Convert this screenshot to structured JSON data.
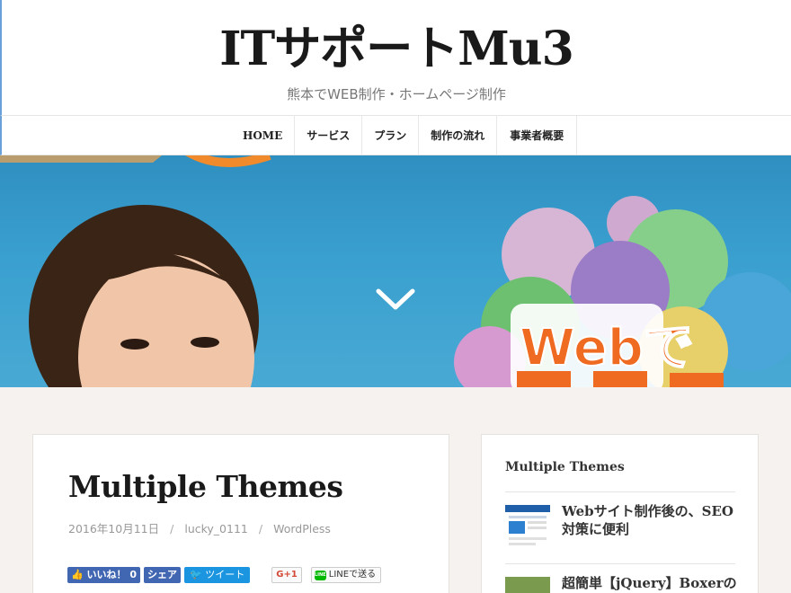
{
  "site": {
    "title": "ITサポートMu3",
    "description": "熊本でWEB制作・ホームページ制作"
  },
  "nav": {
    "items": [
      {
        "label": "HOME"
      },
      {
        "label": "サービス"
      },
      {
        "label": "プラン"
      },
      {
        "label": "制作の流れ"
      },
      {
        "label": "事業者概要"
      }
    ]
  },
  "hero": {
    "balloon_text": "Webで",
    "arrow_icon": "chevron-down-icon"
  },
  "post": {
    "title": "Multiple Themes",
    "date": "2016年10月11日",
    "author": "lucky_0111",
    "category": "WordPless",
    "sep": "/",
    "share": {
      "like_label": "いいね！ 0",
      "share_label": "シェア",
      "tweet_label": "ツイート",
      "gplus_label": "G+1",
      "line_label": "LINEで送る",
      "line_logo": "LINE"
    }
  },
  "widget": {
    "title": "Multiple Themes",
    "items": [
      {
        "text": "Webサイト制作後の、SEO対策に便利"
      },
      {
        "text": "超簡単【jQuery】Boxerの導"
      }
    ]
  },
  "colors": {
    "facebook": "#4267b2",
    "twitter": "#1b95e0",
    "line": "#00b900",
    "sky": "#3aa0cf"
  }
}
